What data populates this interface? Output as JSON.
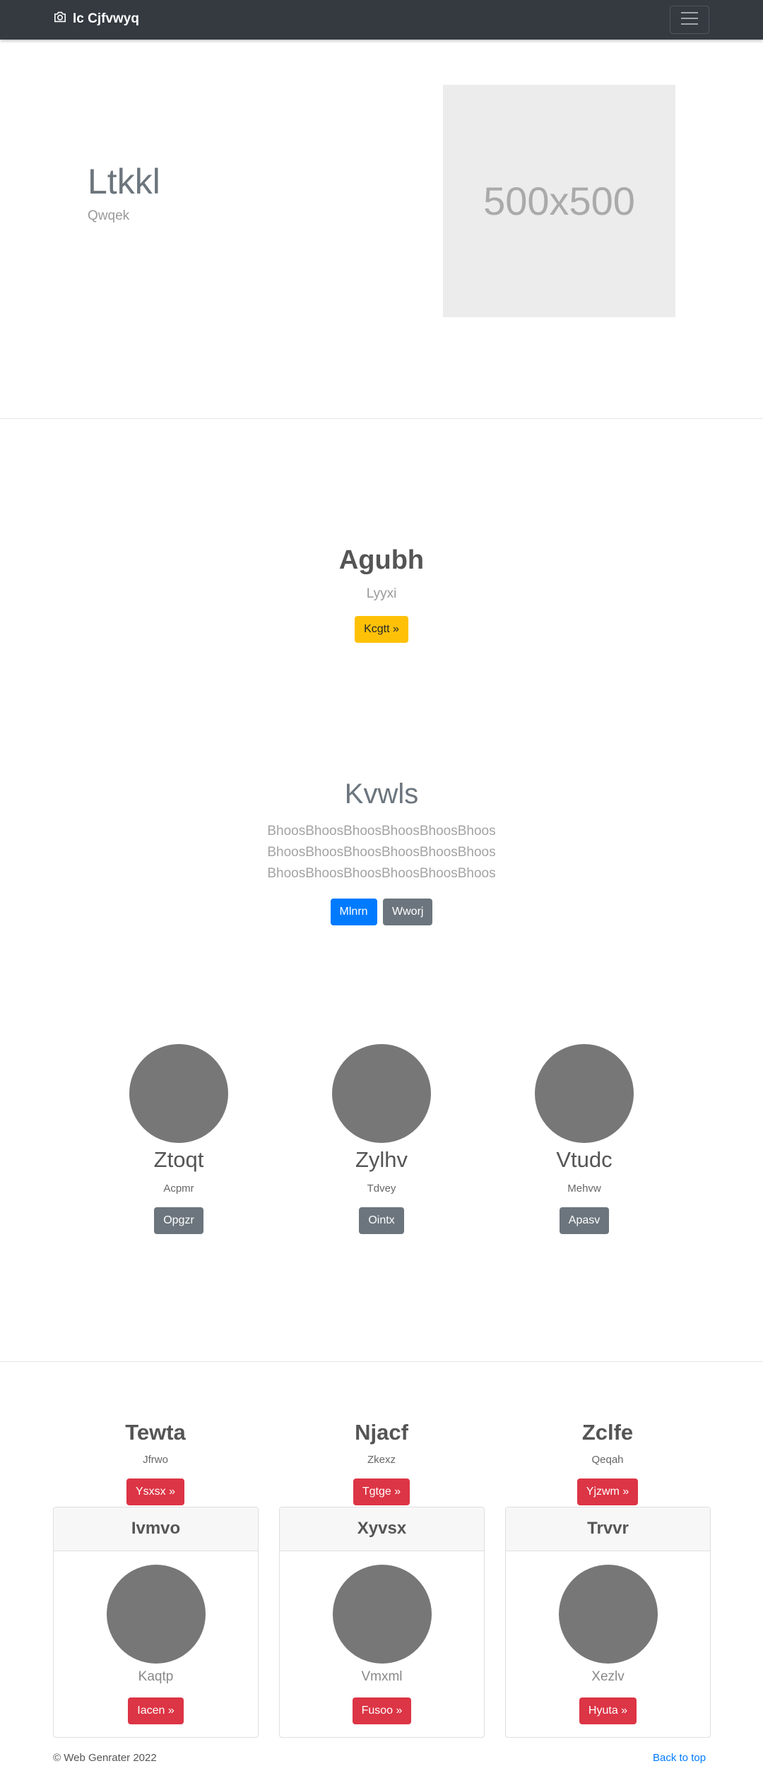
{
  "navbar": {
    "brand": "Ic Cjfvwyq"
  },
  "hero": {
    "title": "Ltkkl",
    "subtitle": "Qwqek",
    "image_placeholder": "500x500"
  },
  "section_agubh": {
    "title": "Agubh",
    "subtitle": "Lyyxi",
    "button": "Kcgtt »"
  },
  "section_kvwls": {
    "title": "Kvwls",
    "lines": [
      "BhoosBhoosBhoosBhoosBhoosBhoos",
      "BhoosBhoosBhoosBhoosBhoosBhoos",
      "BhoosBhoosBhoosBhoosBhoosBhoos"
    ],
    "primary_button": "Mlnrn",
    "secondary_button": "Wworj"
  },
  "people": [
    {
      "name": "Ztoqt",
      "role": "Acpmr",
      "button": "Opgzr"
    },
    {
      "name": "Zylhv",
      "role": "Tdvey",
      "button": "Ointx"
    },
    {
      "name": "Vtudc",
      "role": "Mehvw",
      "button": "Apasv"
    }
  ],
  "columns": [
    {
      "title": "Tewta",
      "subtitle": "Jfrwo",
      "button": "Ysxsx »"
    },
    {
      "title": "Njacf",
      "subtitle": "Zkexz",
      "button": "Tgtge »"
    },
    {
      "title": "Zclfe",
      "subtitle": "Qeqah",
      "button": "Yjzwm »"
    }
  ],
  "cards": [
    {
      "header": "Ivmvo",
      "caption": "Kaqtp",
      "button": "Iacen »"
    },
    {
      "header": "Xyvsx",
      "caption": "Vmxml",
      "button": "Fusoo »"
    },
    {
      "header": "Trvvr",
      "caption": "Xezlv",
      "button": "Hyuta »"
    }
  ],
  "footer": {
    "copyright": "© Web Genrater 2022",
    "back_to_top": "Back to top"
  },
  "colors": {
    "navbar": "#343a40",
    "warning": "#ffc107",
    "primary": "#007bff",
    "secondary": "#6c757d",
    "danger": "#dc3545"
  }
}
